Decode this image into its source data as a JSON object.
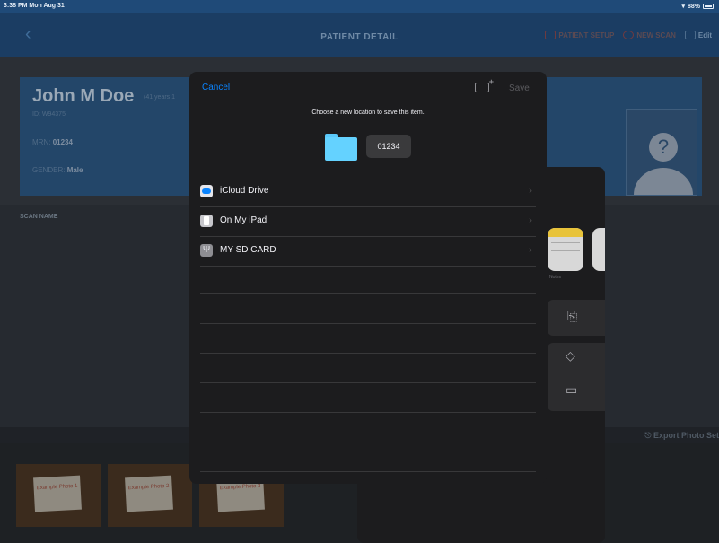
{
  "status_bar": {
    "time": "3:38 PM  Mon Aug 31",
    "battery": "88%"
  },
  "nav": {
    "back_icon": "chevron-left-icon",
    "title": "PATIENT DETAIL",
    "patient_setup": "PATIENT SETUP",
    "new_scan": "NEW SCAN",
    "edit": "Edit"
  },
  "patient": {
    "name": "John M Doe",
    "age": "(41 years 1",
    "id": "ID: W94375",
    "mrn_label": "MRN:",
    "mrn_value": "01234",
    "gender_label": "GENDER:",
    "gender_value": "Male",
    "avatar_glyph": "?"
  },
  "scan_list": {
    "header": "SCAN NAME"
  },
  "export": {
    "label": "Export Photo Set"
  },
  "thumbnails": [
    {
      "text": "Example Photo 1"
    },
    {
      "text": "Example Photo 2"
    },
    {
      "text": "Example Photo 3"
    }
  ],
  "share_sheet": {
    "apps": [
      {
        "label": "Notes",
        "icon": "notes-app-icon"
      }
    ],
    "actions": [
      {
        "icon": "copy-icon"
      },
      {
        "icon": "tag-icon"
      },
      {
        "icon": "folder-icon"
      }
    ]
  },
  "picker": {
    "cancel": "Cancel",
    "save": "Save",
    "prompt": "Choose a new location to save this item.",
    "filename": "01234",
    "locations": [
      {
        "label": "iCloud Drive",
        "icon": "icloud-drive-icon"
      },
      {
        "label": "On My iPad",
        "icon": "ipad-icon"
      },
      {
        "label": "MY SD CARD",
        "icon": "usb-drive-icon"
      }
    ]
  },
  "colors": {
    "accent": "#0a84ff",
    "folder": "#64d2ff",
    "header_bg": "#1b3d63",
    "modal_bg": "#1c1c1e"
  }
}
